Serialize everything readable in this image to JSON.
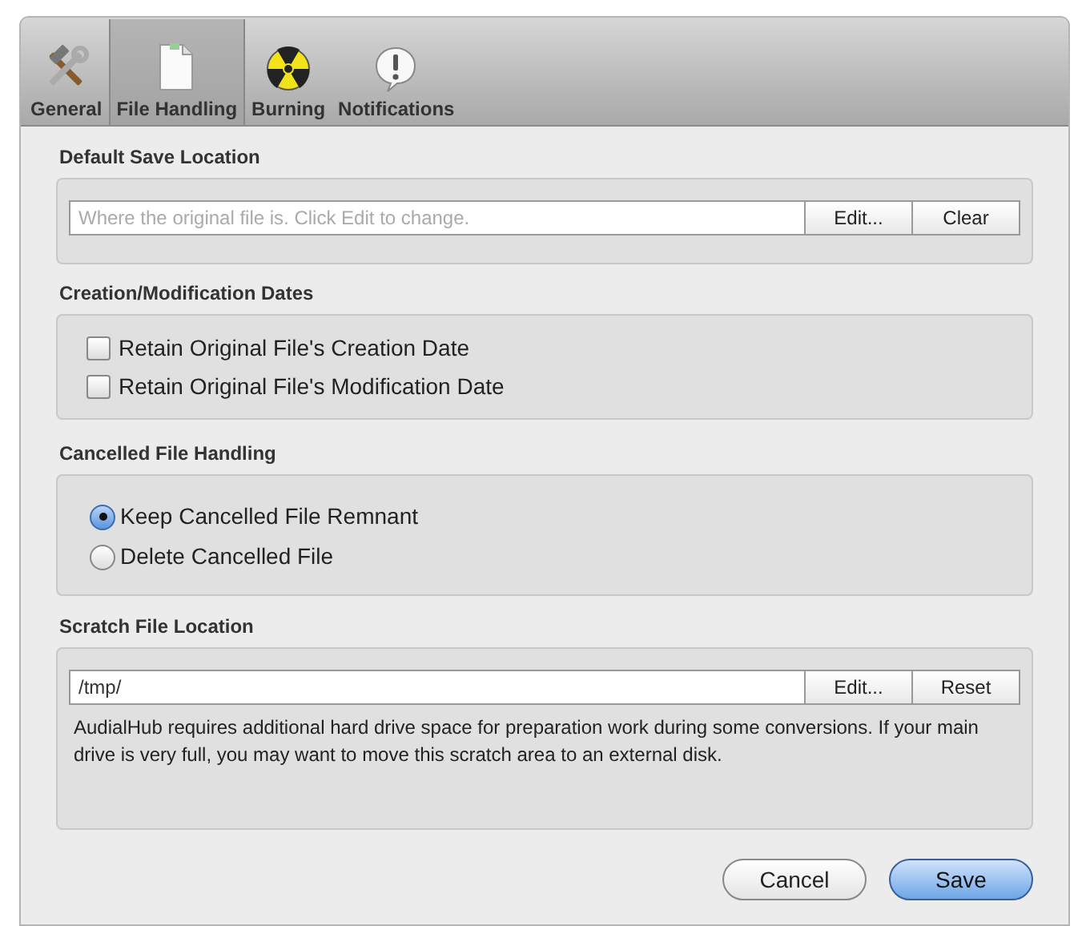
{
  "toolbar": {
    "tabs": [
      {
        "label": "General",
        "kind": "tools",
        "selected": false
      },
      {
        "label": "File Handling",
        "kind": "file",
        "selected": true
      },
      {
        "label": "Burning",
        "kind": "burn",
        "selected": false
      },
      {
        "label": "Notifications",
        "kind": "alert",
        "selected": false
      }
    ]
  },
  "default_save_location": {
    "title": "Default Save Location",
    "field": {
      "placeholder": "Where the original file is. Click Edit to change."
    },
    "buttons": [
      "Edit...",
      "Clear"
    ]
  },
  "creation_modification_dates": {
    "title": "Creation/Modification Dates",
    "options": [
      {
        "label": "Retain Original File's Creation Date",
        "checked": false
      },
      {
        "label": "Retain Original File's Modification Date",
        "checked": false
      }
    ]
  },
  "cancelled_file_handling": {
    "title": "Cancelled File Handling",
    "options": [
      {
        "label": "Keep Cancelled File Remnant",
        "selected": true
      },
      {
        "label": "Delete Cancelled File",
        "selected": false
      }
    ]
  },
  "scratch_file_location": {
    "title": "Scratch File Location",
    "field": {
      "value": "/tmp/"
    },
    "buttons": [
      "Edit...",
      "Reset"
    ],
    "note": "AudialHub requires additional hard drive space for preparation work during some conversions. If your main drive is very full, you may want to move this scratch area to an external disk."
  },
  "buttons": [
    {
      "label": "Cancel",
      "default": false
    },
    {
      "label": "Save",
      "default": true
    }
  ]
}
